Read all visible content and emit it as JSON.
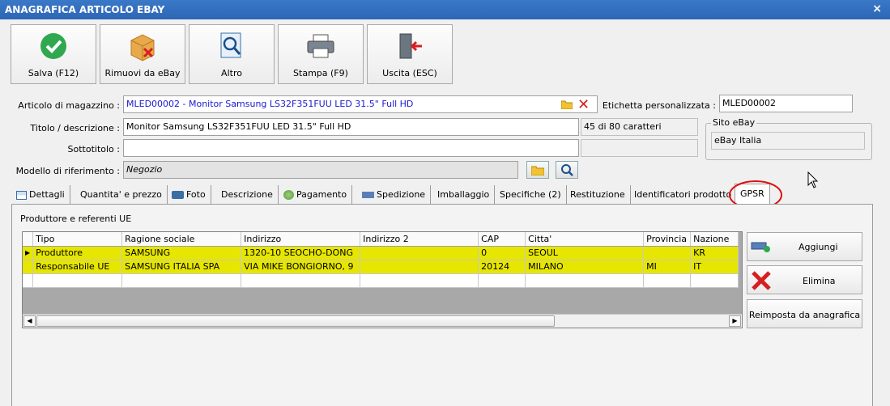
{
  "window": {
    "title": "ANAGRAFICA ARTICOLO EBAY",
    "close": "×"
  },
  "toolbar": {
    "save": "Salva (F12)",
    "remove": "Rimuovi da eBay",
    "other": "Altro",
    "print": "Stampa (F9)",
    "exit": "Uscita (ESC)"
  },
  "form": {
    "article_label": "Articolo di magazzino :",
    "article_value": "MLED00002 - Monitor Samsung LS32F351FUU LED 31.5\" Full HD",
    "custom_label_label": "Etichetta personalizzata :",
    "custom_label_value": "MLED00002",
    "title_label": "Titolo / descrizione :",
    "title_value": "Monitor Samsung LS32F351FUU LED 31.5\" Full HD",
    "char_count": "45 di 80 caratteri",
    "subtitle_label": "Sottotitolo :",
    "subtitle_value": "",
    "model_label": "Modello di riferimento :",
    "model_value": "Negozio",
    "site_group_label": "Sito eBay",
    "site_value": "eBay Italia"
  },
  "tabs": [
    "Dettagli",
    "Quantita' e prezzo",
    "Foto",
    "Descrizione",
    "Pagamento",
    "Spedizione",
    "Imballaggio",
    "Specifiche (2)",
    "Restituzione",
    "Identificatori prodotto",
    "GPSR"
  ],
  "panel": {
    "section_title": "Produttore e referenti UE",
    "columns": [
      "Tipo",
      "Ragione sociale",
      "Indirizzo",
      "Indirizzo 2",
      "CAP",
      "Citta'",
      "Provincia",
      "Nazione"
    ],
    "rows": [
      [
        "Produttore",
        "SAMSUNG",
        "1320-10 SEOCHO-DONG",
        "",
        "0",
        "SEOUL",
        "",
        "KR"
      ],
      [
        "Responsabile UE",
        "SAMSUNG ITALIA SPA",
        "VIA MIKE BONGIORNO, 9",
        "",
        "20124",
        "MILANO",
        "MI",
        "IT"
      ]
    ],
    "add": "Aggiungi",
    "delete": "Elimina",
    "reset": "Reimposta da anagrafica"
  },
  "colors": {
    "highlight": "#e6e600",
    "link_blue": "#1a1ad0",
    "annotation_red": "#e01010"
  }
}
